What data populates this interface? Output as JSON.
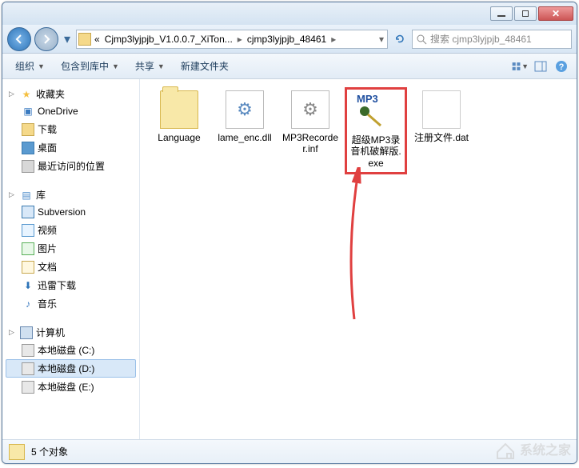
{
  "titlebar": {},
  "nav": {
    "crumb_root": "«",
    "crumb1": "Cjmp3lyjpjb_V1.0.0.7_XiTon...",
    "crumb2": "cjmp3lyjpjb_48461"
  },
  "search": {
    "placeholder": "搜索 cjmp3lyjpjb_48461"
  },
  "toolbar": {
    "organize": "组织",
    "include": "包含到库中",
    "share": "共享",
    "newfolder": "新建文件夹"
  },
  "sidebar": {
    "favorites": {
      "header": "收藏夹",
      "items": [
        "OneDrive",
        "下载",
        "桌面",
        "最近访问的位置"
      ]
    },
    "libraries": {
      "header": "库",
      "items": [
        "Subversion",
        "视频",
        "图片",
        "文档",
        "迅雷下载",
        "音乐"
      ]
    },
    "computer": {
      "header": "计算机",
      "items": [
        "本地磁盘 (C:)",
        "本地磁盘 (D:)",
        "本地磁盘 (E:)"
      ]
    }
  },
  "files": [
    {
      "name": "Language",
      "type": "folder"
    },
    {
      "name": "lame_enc.dll",
      "type": "dll"
    },
    {
      "name": "MP3Recorder.inf",
      "type": "inf"
    },
    {
      "name": "超级MP3录音机破解版.exe",
      "type": "exe",
      "icon_label_top": "MP3",
      "highlighted": true
    },
    {
      "name": "注册文件.dat",
      "type": "dat"
    }
  ],
  "status": {
    "count": "5 个对象"
  },
  "watermark": "系统之家"
}
